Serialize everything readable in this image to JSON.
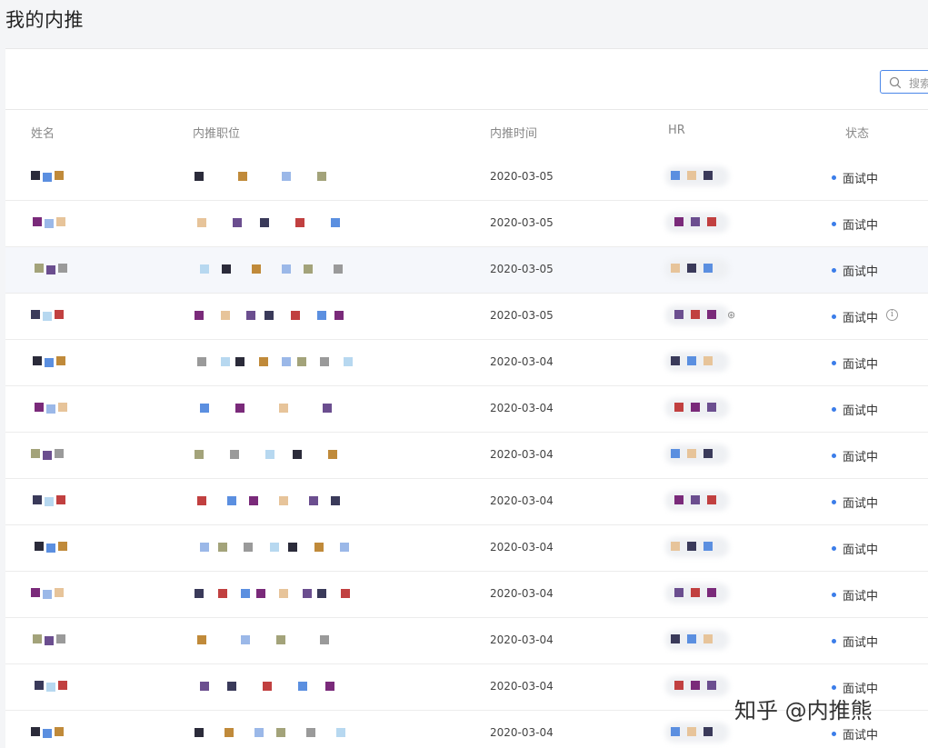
{
  "page": {
    "title": "我的内推"
  },
  "search": {
    "placeholder": "搜索"
  },
  "table": {
    "columns": [
      "姓名",
      "内推职位",
      "内推时间",
      "HR",
      "状态"
    ],
    "rows": [
      {
        "date": "2020-03-05",
        "status": "面试中"
      },
      {
        "date": "2020-03-05",
        "status": "面试中"
      },
      {
        "date": "2020-03-05",
        "status": "面试中"
      },
      {
        "date": "2020-03-05",
        "status": "面试中"
      },
      {
        "date": "2020-03-04",
        "status": "面试中"
      },
      {
        "date": "2020-03-04",
        "status": "面试中"
      },
      {
        "date": "2020-03-04",
        "status": "面试中"
      },
      {
        "date": "2020-03-04",
        "status": "面试中"
      },
      {
        "date": "2020-03-04",
        "status": "面试中"
      },
      {
        "date": "2020-03-04",
        "status": "面试中"
      },
      {
        "date": "2020-03-04",
        "status": "面试中"
      },
      {
        "date": "2020-03-04",
        "status": "面试中"
      },
      {
        "date": "2020-03-04",
        "status": "面试中"
      }
    ]
  },
  "watermark": {
    "text": "知乎 @内推熊"
  },
  "colors": {
    "accent": "#3b7de9",
    "status_dot": "#3b7de9"
  }
}
